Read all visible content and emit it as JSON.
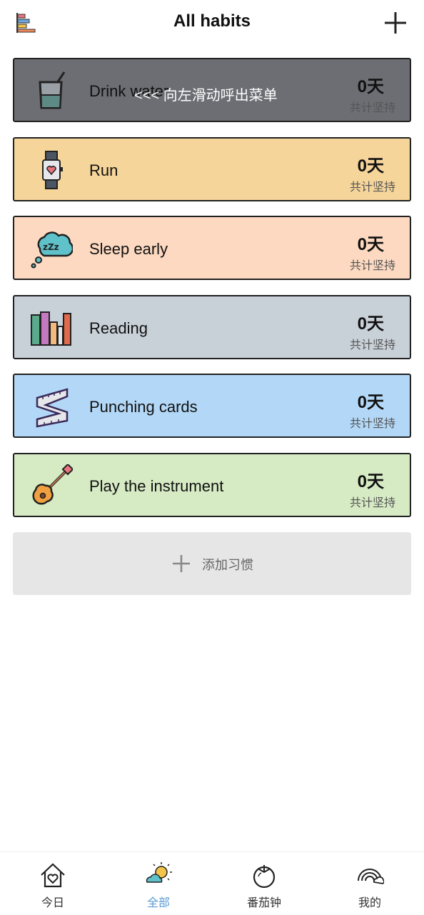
{
  "header": {
    "title": "All habits"
  },
  "habits": [
    {
      "name": "Drink water",
      "days": "0天",
      "days_label": "共计坚持",
      "color": "#6d6e74",
      "icon": "drink-icon",
      "hint": "<<< 向左滑动呼出菜单"
    },
    {
      "name": "Run",
      "days": "0天",
      "days_label": "共计坚持",
      "color": "#f6d59a",
      "icon": "watch-icon"
    },
    {
      "name": "Sleep early",
      "days": "0天",
      "days_label": "共计坚持",
      "color": "#fcd9c0",
      "icon": "sleep-icon"
    },
    {
      "name": "Reading",
      "days": "0天",
      "days_label": "共计坚持",
      "color": "#c9d1d8",
      "icon": "books-icon"
    },
    {
      "name": "Punching cards",
      "days": "0天",
      "days_label": "共计坚持",
      "color": "#b3d8f7",
      "icon": "measuring-tape-icon"
    },
    {
      "name": "Play the instrument",
      "days": "0天",
      "days_label": "共计坚持",
      "color": "#d6ebc4",
      "icon": "guitar-icon"
    }
  ],
  "add_habit": {
    "label": "添加习惯"
  },
  "tabs": [
    {
      "label": "今日",
      "icon": "home-heart-icon"
    },
    {
      "label": "全部",
      "icon": "weather-icon",
      "active": true
    },
    {
      "label": "番茄钟",
      "icon": "tomato-icon"
    },
    {
      "label": "我的",
      "icon": "rainbow-icon"
    }
  ]
}
